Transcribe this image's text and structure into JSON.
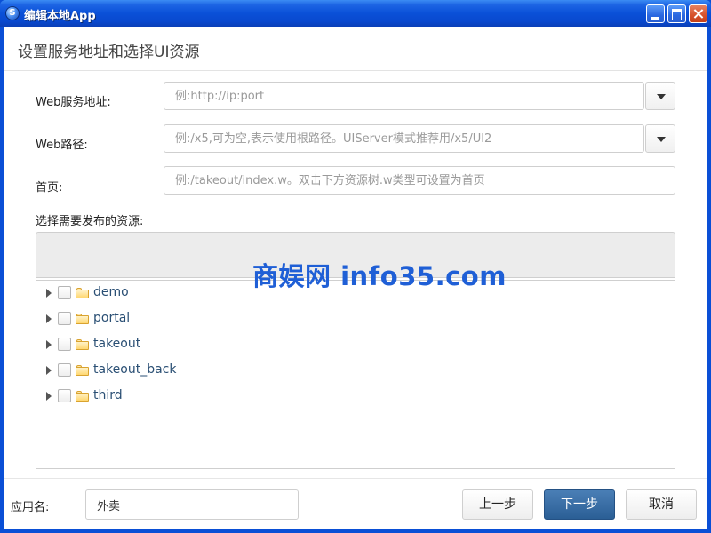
{
  "window": {
    "title": "编辑本地App",
    "app_icon_glyph": "S"
  },
  "header": {
    "title": "设置服务地址和选择UI资源"
  },
  "form": {
    "web_service": {
      "label": "Web服务地址:",
      "placeholder": "例:http://ip:port",
      "value": ""
    },
    "web_path": {
      "label": "Web路径:",
      "placeholder": "例:/x5,可为空,表示使用根路径。UIServer模式推荐用/x5/UI2",
      "value": ""
    },
    "home_page": {
      "label": "首页:",
      "placeholder": "例:/takeout/index.w。双击下方资源树.w类型可设置为首页",
      "value": ""
    },
    "resources_label": "选择需要发布的资源:"
  },
  "tree": {
    "items": [
      {
        "label": "demo"
      },
      {
        "label": "portal"
      },
      {
        "label": "takeout"
      },
      {
        "label": "takeout_back"
      },
      {
        "label": "third"
      }
    ]
  },
  "watermark": "商娱网 info35.com",
  "footer": {
    "app_name_label": "应用名:",
    "app_name_value": "外卖",
    "prev_label": "上一步",
    "next_label": "下一步",
    "cancel_label": "取消"
  },
  "colors": {
    "titlebar": "#0a50d8",
    "primary_button": "#2b5f95",
    "tree_text": "#2a4f74",
    "watermark": "#1f5fd6"
  }
}
